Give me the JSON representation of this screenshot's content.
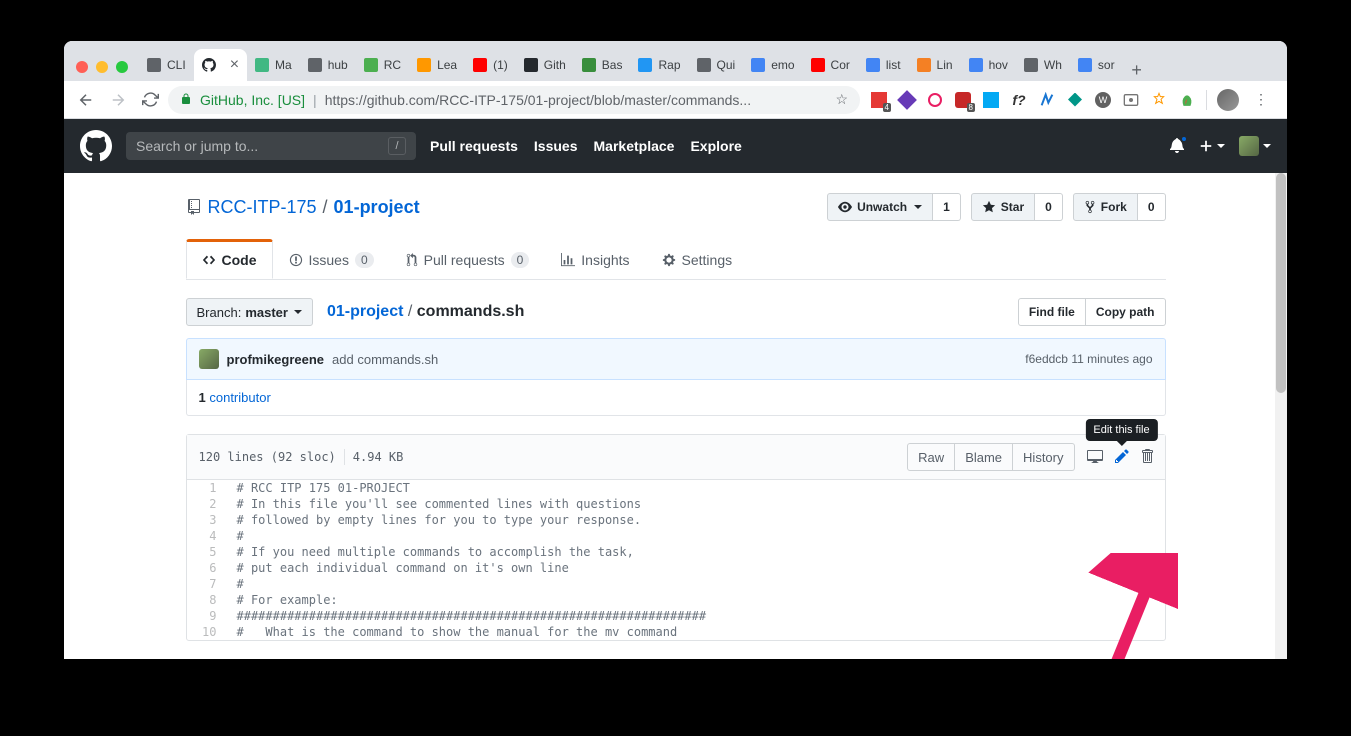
{
  "browser": {
    "tabs": [
      {
        "title": "CLI"
      },
      {
        "title": ""
      },
      {
        "title": "Ma"
      },
      {
        "title": "hub"
      },
      {
        "title": "RC"
      },
      {
        "title": "Lea"
      },
      {
        "title": "(1)"
      },
      {
        "title": "Gith"
      },
      {
        "title": "Bas"
      },
      {
        "title": "Rap"
      },
      {
        "title": "Qui"
      },
      {
        "title": "emo"
      },
      {
        "title": "Cor"
      },
      {
        "title": "list"
      },
      {
        "title": "Lin"
      },
      {
        "title": "hov"
      },
      {
        "title": "Wh"
      },
      {
        "title": "sor"
      }
    ],
    "active_tab": 1,
    "url_host_label": "GitHub, Inc. [US]",
    "url_path": "https://github.com/RCC-ITP-175/01-project/blob/master/commands..."
  },
  "gh_header": {
    "search_placeholder": "Search or jump to...",
    "nav": [
      "Pull requests",
      "Issues",
      "Marketplace",
      "Explore"
    ]
  },
  "repo": {
    "owner": "RCC-ITP-175",
    "name": "01-project",
    "actions": {
      "watch_label": "Unwatch",
      "watch_count": "1",
      "star_label": "Star",
      "star_count": "0",
      "fork_label": "Fork",
      "fork_count": "0"
    },
    "tabs": {
      "code": "Code",
      "issues": "Issues",
      "issues_count": "0",
      "pulls": "Pull requests",
      "pulls_count": "0",
      "insights": "Insights",
      "settings": "Settings"
    }
  },
  "branch": {
    "label": "Branch:",
    "name": "master"
  },
  "breadcrumb": {
    "parent": "01-project",
    "file": "commands.sh"
  },
  "file_nav": {
    "find": "Find file",
    "copy": "Copy path"
  },
  "commit": {
    "author": "profmikegreene",
    "message": "add commands.sh",
    "sha": "f6eddcb",
    "time": "11 minutes ago"
  },
  "contributors": {
    "count": "1",
    "label": "contributor"
  },
  "file_header": {
    "stats": "120 lines (92 sloc)",
    "size": "4.94 KB",
    "raw": "Raw",
    "blame": "Blame",
    "history": "History",
    "tooltip": "Edit this file"
  },
  "code_lines": [
    "# RCC ITP 175 01-PROJECT",
    "# In this file you'll see commented lines with questions",
    "# followed by empty lines for you to type your response.",
    "#",
    "# If you need multiple commands to accomplish the task,",
    "# put each individual command on it's own line",
    "#",
    "# For example:",
    "#################################################################",
    "#   What is the command to show the manual for the mv command"
  ]
}
